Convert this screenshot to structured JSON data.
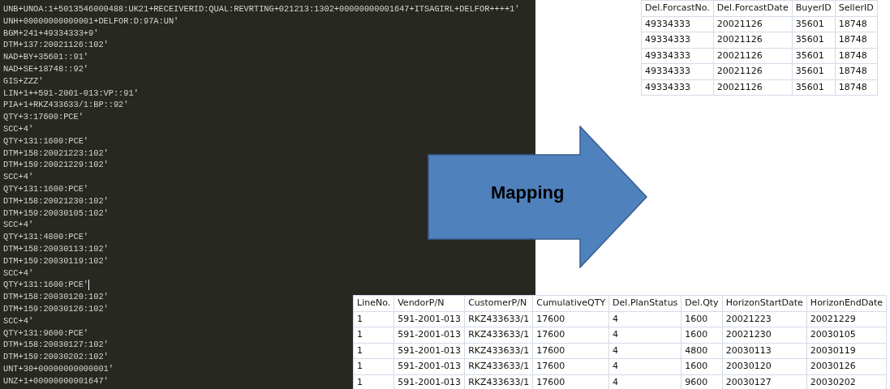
{
  "editor": {
    "lines": [
      {
        "text": "UNB+UNOA:1+5013546000488:UK21+RECEIVERID:QUAL:REVRTING+021213:1302+00000000001647+ITSAGIRL+DELFOR++++1'",
        "cursor": false
      },
      {
        "text": "UNH+00000000000001+DELFOR:D:97A:UN'",
        "cursor": false
      },
      {
        "text": "BGM+241+49334333+9'",
        "cursor": false
      },
      {
        "text": "DTM+137:20021126:102'",
        "cursor": false
      },
      {
        "text": "NAD+BY+35601::91'",
        "cursor": false
      },
      {
        "text": "NAD+SE+18748::92'",
        "cursor": false
      },
      {
        "text": "GIS+ZZZ'",
        "cursor": false
      },
      {
        "text": "LIN+1++591-2001-013:VP::91'",
        "cursor": false
      },
      {
        "text": "PIA+1+RKZ433633/1:BP::92'",
        "cursor": false
      },
      {
        "text": "QTY+3:17600:PCE'",
        "cursor": false
      },
      {
        "text": "SCC+4'",
        "cursor": false
      },
      {
        "text": "QTY+131:1600:PCE'",
        "cursor": false
      },
      {
        "text": "DTM+158:20021223:102'",
        "cursor": false
      },
      {
        "text": "DTM+159:20021229:102'",
        "cursor": false
      },
      {
        "text": "SCC+4'",
        "cursor": false
      },
      {
        "text": "QTY+131:1600:PCE'",
        "cursor": false
      },
      {
        "text": "DTM+158:20021230:102'",
        "cursor": false
      },
      {
        "text": "DTM+159:20030105:102'",
        "cursor": false
      },
      {
        "text": "SCC+4'",
        "cursor": false
      },
      {
        "text": "QTY+131:4800:PCE'",
        "cursor": false
      },
      {
        "text": "DTM+158:20030113:102'",
        "cursor": false
      },
      {
        "text": "DTM+159:20030119:102'",
        "cursor": false
      },
      {
        "text": "SCC+4'",
        "cursor": false
      },
      {
        "text": "QTY+131:1600:PCE'",
        "cursor": true
      },
      {
        "text": "DTM+158:20030120:102'",
        "cursor": false
      },
      {
        "text": "DTM+159:20030126:102'",
        "cursor": false
      },
      {
        "text": "SCC+4'",
        "cursor": false
      },
      {
        "text": "QTY+131:9600:PCE'",
        "cursor": false
      },
      {
        "text": "DTM+158:20030127:102'",
        "cursor": false
      },
      {
        "text": "DTM+159:20030202:102'",
        "cursor": false
      },
      {
        "text": "UNT+30+00000000000001'",
        "cursor": false
      },
      {
        "text": "UNZ+1+00000000001647'",
        "cursor": false
      }
    ]
  },
  "arrow": {
    "label": "Mapping"
  },
  "header_table": {
    "columns": [
      "Del.ForcastNo.",
      "Del.ForcastDate",
      "BuyerID",
      "SellerID"
    ],
    "rows": [
      [
        "49334333",
        "20021126",
        "35601",
        "18748"
      ],
      [
        "49334333",
        "20021126",
        "35601",
        "18748"
      ],
      [
        "49334333",
        "20021126",
        "35601",
        "18748"
      ],
      [
        "49334333",
        "20021126",
        "35601",
        "18748"
      ],
      [
        "49334333",
        "20021126",
        "35601",
        "18748"
      ]
    ]
  },
  "lines_table": {
    "columns": [
      "LineNo.",
      "VendorP/N",
      "CustomerP/N",
      "CumulativeQTY",
      "Del.PlanStatus",
      "Del.Qty",
      "HorizonStartDate",
      "HorizonEndDate"
    ],
    "rows": [
      [
        "1",
        "591-2001-013",
        "RKZ433633/1",
        "17600",
        "4",
        "1600",
        "20021223",
        "20021229"
      ],
      [
        "1",
        "591-2001-013",
        "RKZ433633/1",
        "17600",
        "4",
        "1600",
        "20021230",
        "20030105"
      ],
      [
        "1",
        "591-2001-013",
        "RKZ433633/1",
        "17600",
        "4",
        "4800",
        "20030113",
        "20030119"
      ],
      [
        "1",
        "591-2001-013",
        "RKZ433633/1",
        "17600",
        "4",
        "1600",
        "20030120",
        "20030126"
      ],
      [
        "1",
        "591-2001-013",
        "RKZ433633/1",
        "17600",
        "4",
        "9600",
        "20030127",
        "20030202"
      ]
    ]
  }
}
